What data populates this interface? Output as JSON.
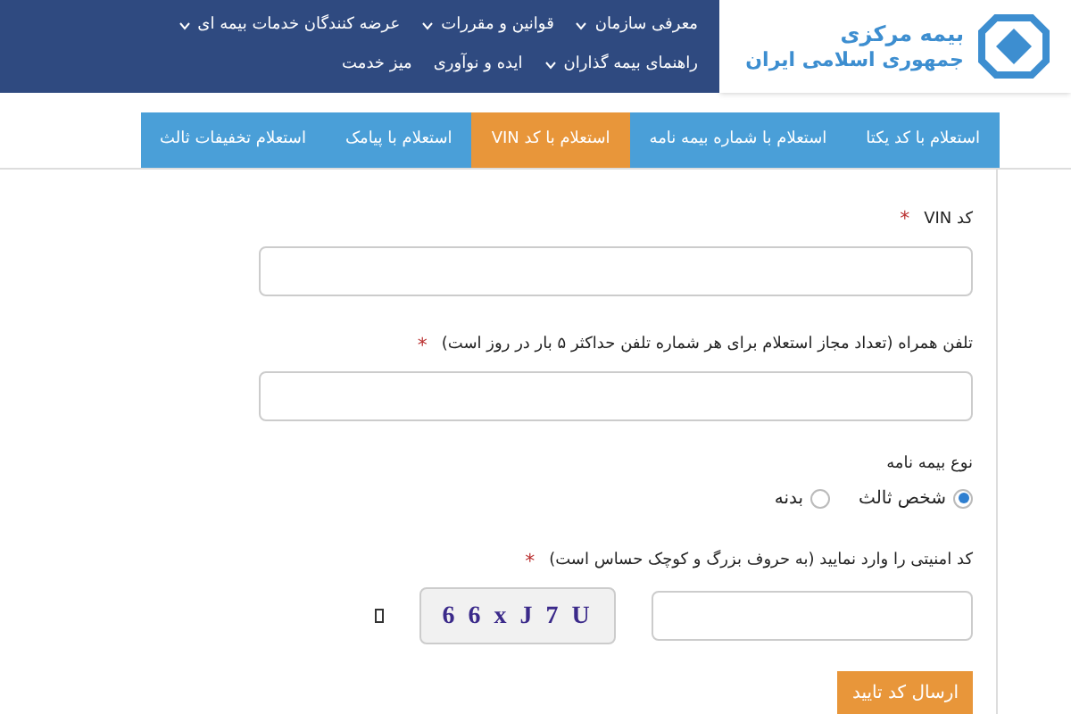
{
  "logo": {
    "line_1": "بیمه مرکزی",
    "line_2": "جمهوری اسلامی ایران"
  },
  "menu": [
    {
      "label": "معرفی سازمان",
      "has_submenu": true
    },
    {
      "label": "قوانین و مقررات",
      "has_submenu": true
    },
    {
      "label": "عرضه کنندگان خدمات بیمه ای",
      "has_submenu": true
    },
    {
      "label": "راهنمای بیمه گذاران",
      "has_submenu": true
    },
    {
      "label": "ایده و نوآوری",
      "has_submenu": false
    },
    {
      "label": "میز خدمت",
      "has_submenu": false
    }
  ],
  "tabs": [
    {
      "label": "استعلام با کد یکتا",
      "selected": false
    },
    {
      "label": "استعلام با شماره بیمه نامه",
      "selected": false
    },
    {
      "label": "استعلام با کد VIN",
      "selected": true
    },
    {
      "label": "استعلام با پیامک",
      "selected": false
    },
    {
      "label": "استعلام تخفیفات ثالث",
      "selected": false
    }
  ],
  "fields": [
    {
      "label": "کد VIN",
      "required_mark": "*"
    },
    {
      "label": "تلفن همراه (تعداد مجاز استعلام برای هر شماره تلفن حداکثر ۵ بار در روز است)",
      "required_mark": "*"
    }
  ],
  "policy_type": {
    "label": "نوع بیمه نامه",
    "options": [
      {
        "label": "شخص ثالث",
        "selected": true
      },
      {
        "label": "بدنه",
        "selected": false
      }
    ]
  },
  "captcha": {
    "label": "کد امنیتی را وارد نمایید (به حروف بزرگ و کوچک حساس است)",
    "required_mark": "*",
    "code": "6 6 x J 7 U"
  },
  "submit_button": "ارسال کد تایید"
}
